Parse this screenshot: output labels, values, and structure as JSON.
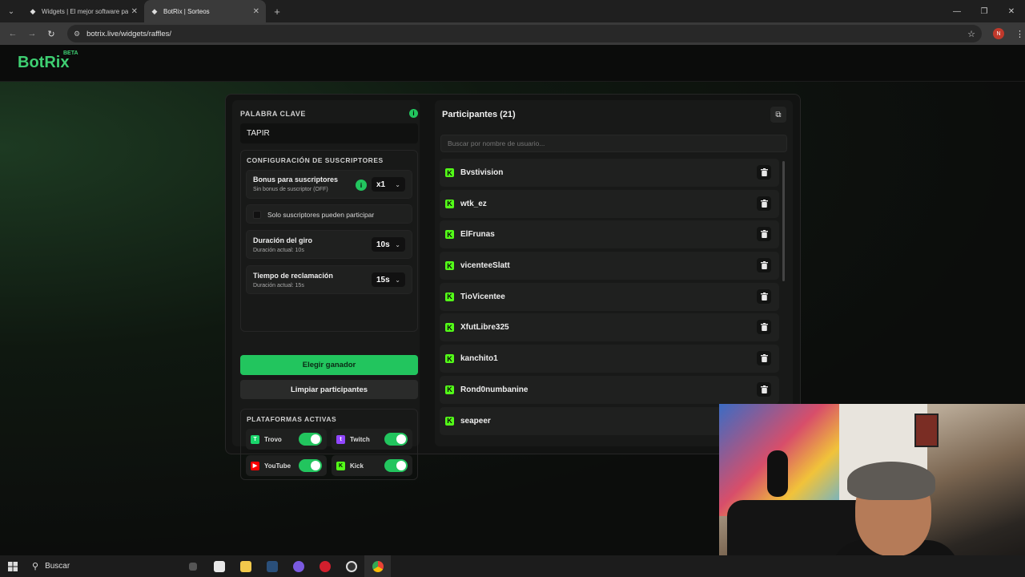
{
  "browser": {
    "tabs": [
      {
        "label": "Widgets | El mejor software pa",
        "active": false
      },
      {
        "label": "BotRix | Sorteos",
        "active": true
      }
    ],
    "new_tab": "+",
    "url": "botrix.live/widgets/raffles/",
    "profile_initial": "N"
  },
  "header": {
    "logo": "BotRix",
    "beta": "BETA"
  },
  "keyword": {
    "label": "PALABRA CLAVE",
    "value": "TAPIR"
  },
  "subscribers": {
    "title": "CONFIGURACIÓN DE SUSCRIPTORES",
    "bonus": {
      "title": "Bonus para suscriptores",
      "subtitle": "Sin bonus de suscriptor (OFF)",
      "value": "x1"
    },
    "only_subs": {
      "label": "Solo suscriptores pueden participar",
      "checked": false
    },
    "spin": {
      "title": "Duración del giro",
      "subtitle": "Duración actual: 10s",
      "value": "10s"
    },
    "claim": {
      "title": "Tiempo de reclamación",
      "subtitle": "Duración actual: 15s",
      "value": "15s"
    }
  },
  "actions": {
    "pick_winner": "Elegir ganador",
    "clear": "Limpiar participantes"
  },
  "platforms": {
    "title": "PLATAFORMAS ACTIVAS",
    "items": [
      {
        "name": "Trovo",
        "enabled": true,
        "color": "#19d66b"
      },
      {
        "name": "Twitch",
        "enabled": true,
        "color": "#9146ff"
      },
      {
        "name": "YouTube",
        "enabled": true,
        "color": "#ff0000"
      },
      {
        "name": "Kick",
        "enabled": true,
        "color": "#53fc18"
      }
    ]
  },
  "participants": {
    "title": "Participantes (21)",
    "search_placeholder": "Buscar por nombre de usuario...",
    "items": [
      "Bvstivision",
      "wtk_ez",
      "ElFrunas",
      "vicenteeSlatt",
      "TioVicentee",
      "XfutLibre325",
      "kanchito1",
      "Rond0numbanine",
      "seapeer"
    ]
  },
  "taskbar": {
    "search": "Buscar"
  },
  "colors": {
    "accent": "#22c55e",
    "kick": "#53fc18"
  }
}
